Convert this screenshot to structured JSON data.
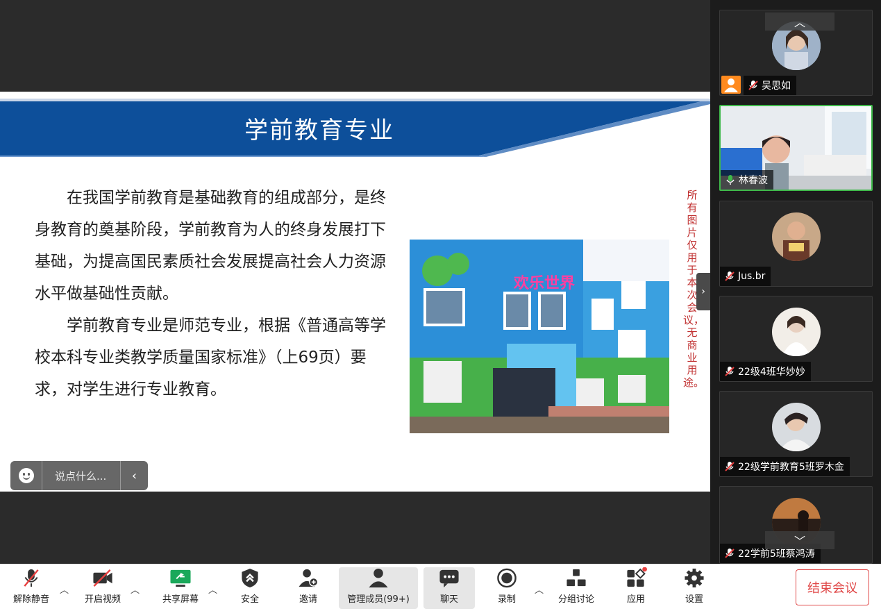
{
  "slide": {
    "title": "学前教育专业",
    "paragraph1": "在我国学前教育是基础教育的组成部分，是终身教育的奠基阶段，学前教育为人的终身发展打下基础，为提高国民素质社会发展提高社会人力资源水平做基础性贡献。",
    "paragraph2": "学前教育专业是师范专业，根据《普通高等学校本科专业类教学质量国家标准》（上69页）要求，对学生进行专业教育。",
    "photo_sign": "欢乐世界",
    "side_note": "所有图片仅用于本次会议，无商业用途。"
  },
  "chat": {
    "placeholder": "说点什么..."
  },
  "participants": [
    {
      "name": "吴思如",
      "muted": true,
      "host": true
    },
    {
      "name": "林春波",
      "muted": false,
      "speaking": true
    },
    {
      "name": "Jus.br",
      "muted": true
    },
    {
      "name": "22级4班华妙妙",
      "muted": true
    },
    {
      "name": "22级学前教育5班罗木金",
      "muted": true
    },
    {
      "name": "22学前5班蔡鸿涛",
      "muted": true
    }
  ],
  "toolbar": {
    "unmute": "解除静音",
    "start_video": "开启视频",
    "share_screen": "共享屏幕",
    "security": "安全",
    "invite": "邀请",
    "manage_members": "管理成员(99+)",
    "chat": "聊天",
    "record": "录制",
    "breakout": "分组讨论",
    "apps": "应用",
    "settings": "设置",
    "end_meeting": "结束会议"
  },
  "colors": {
    "banner_blue": "#0d4f9a",
    "active_green": "#3fb94a",
    "end_red": "#e04848",
    "share_green": "#1aa85a",
    "host_orange": "#ff8a1e"
  }
}
